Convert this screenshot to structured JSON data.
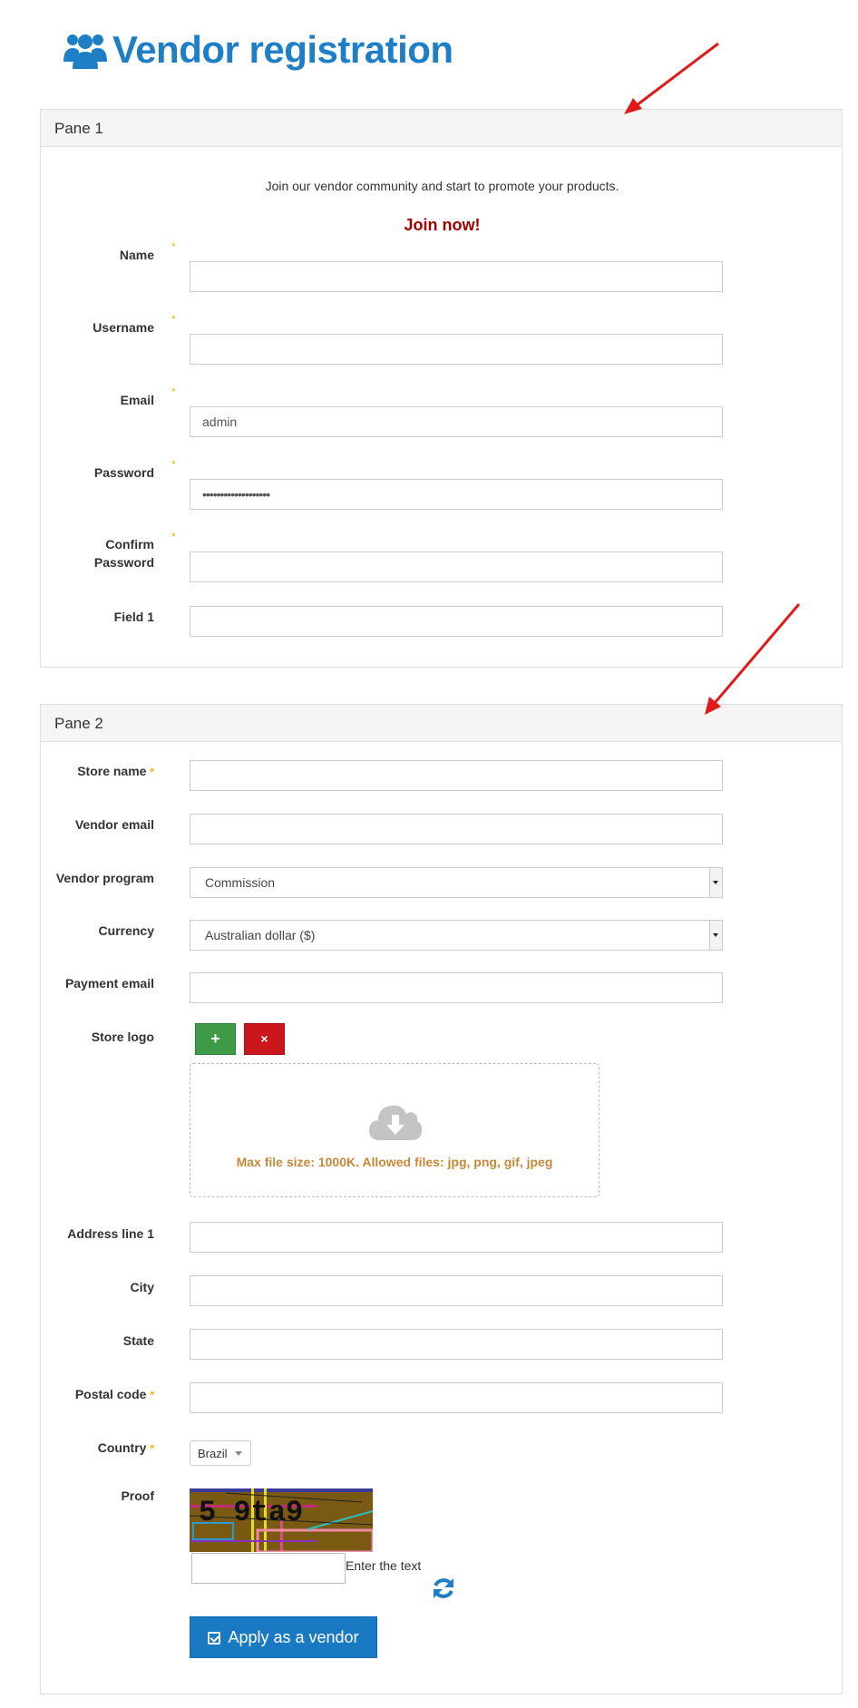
{
  "page": {
    "title": "Vendor registration"
  },
  "pane1": {
    "header": "Pane 1",
    "intro": "Join our vendor community and start to promote your products.",
    "join_now": "Join now!",
    "fields": {
      "name": {
        "label": "Name",
        "value": ""
      },
      "username": {
        "label": "Username",
        "value": ""
      },
      "email": {
        "label": "Email",
        "value": "admin"
      },
      "password": {
        "label": "Password",
        "value": "•••••••••••••••••••"
      },
      "confirm_password": {
        "label_line1": "Confirm",
        "label_line2": "Password",
        "value": ""
      },
      "field1": {
        "label": "Field 1",
        "value": ""
      }
    },
    "required_mark": "*"
  },
  "pane2": {
    "header": "Pane 2",
    "fields": {
      "store_name": {
        "label": "Store name",
        "value": ""
      },
      "vendor_email": {
        "label": "Vendor email",
        "value": ""
      },
      "vendor_program": {
        "label": "Vendor program",
        "selected": "Commission"
      },
      "currency": {
        "label": "Currency",
        "selected": "Australian dollar ($)"
      },
      "payment_email": {
        "label": "Payment email",
        "value": ""
      },
      "store_logo": {
        "label": "Store logo",
        "add_label": "+",
        "remove_label": "×",
        "dropzone_text": "Max file size: 1000K. Allowed files: jpg, png, gif, jpeg"
      },
      "address_line1": {
        "label": "Address line 1",
        "value": ""
      },
      "city": {
        "label": "City",
        "value": ""
      },
      "state": {
        "label": "State",
        "value": ""
      },
      "postal_code": {
        "label": "Postal code",
        "value": ""
      },
      "country": {
        "label": "Country",
        "selected": "Brazil"
      },
      "proof": {
        "label": "Proof",
        "captcha_text": "5 9ta9",
        "input_value": "",
        "hint": "Enter the text"
      }
    },
    "required_mark": "*",
    "submit_label": "Apply as a vendor"
  },
  "colors": {
    "brand_blue": "#1e7fc6",
    "button_blue": "#1979c3",
    "join_red": "#a30000",
    "required_yellow": "#f0b400",
    "add_green": "#3f9a48",
    "remove_red": "#c9171c",
    "dropzone_text": "#c7883a",
    "annotation_arrow": "#e01b1b"
  },
  "icons": {
    "title": "users-icon",
    "upload": "cloud-download-icon",
    "refresh": "refresh-icon",
    "submit": "check-square-icon"
  }
}
